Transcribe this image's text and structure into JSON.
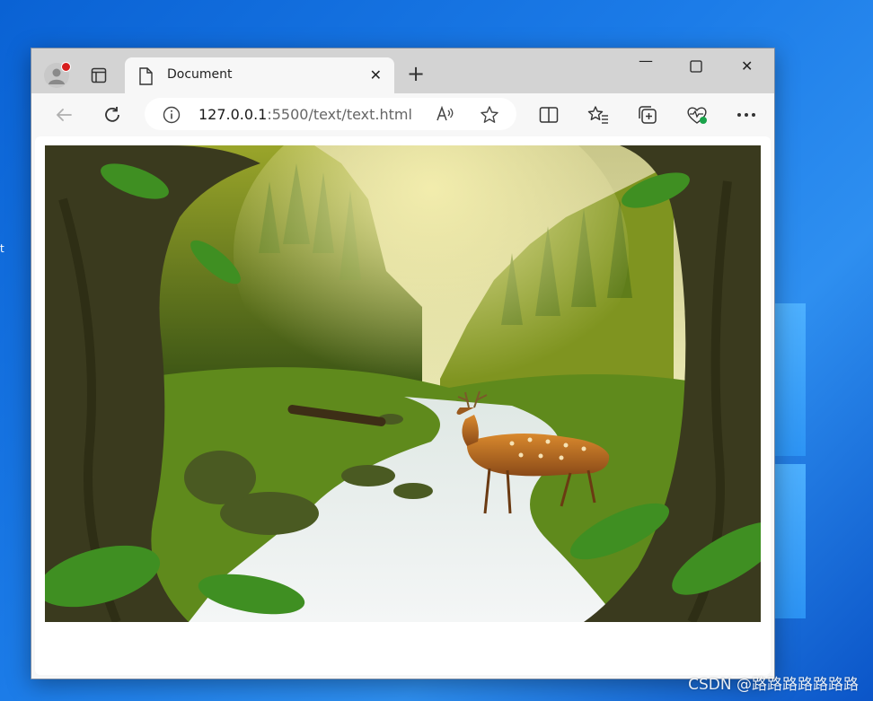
{
  "desktop": {
    "edge_text": "t",
    "watermark": "CSDN @路路路路路路路"
  },
  "tab": {
    "title": "Document"
  },
  "addressbar": {
    "url_host": "127.0.0.1",
    "url_rest": ":5500/text/text.html"
  },
  "icons": {
    "profile": "profile-icon",
    "tabs": "tab-actions-icon",
    "document": "document-icon",
    "close": "close-icon",
    "new_tab": "plus-icon",
    "minimize": "minimize-icon",
    "maximize": "maximize-icon",
    "window_close": "window-close-icon",
    "back": "back-arrow-icon",
    "refresh": "refresh-icon",
    "info": "info-icon",
    "read_aloud": "read-aloud-icon",
    "favorite": "star-icon",
    "split": "split-screen-icon",
    "favorites": "favorites-icon",
    "collections": "collections-icon",
    "health": "browser-essentials-icon",
    "more": "more-icon"
  },
  "image": {
    "subject": "forest stream with deer"
  }
}
